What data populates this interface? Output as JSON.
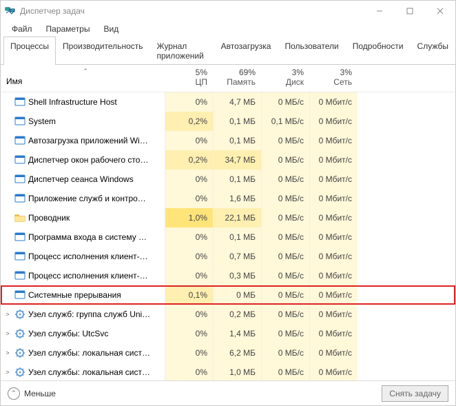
{
  "window": {
    "title": "Диспетчер задач"
  },
  "menu": {
    "file": "Файл",
    "options": "Параметры",
    "view": "Вид"
  },
  "tabs": {
    "processes": "Процессы",
    "performance": "Производительность",
    "apphistory": "Журнал приложений",
    "startup": "Автозагрузка",
    "users": "Пользователи",
    "details": "Подробности",
    "services": "Службы"
  },
  "columns": {
    "name": "Имя",
    "cpu": {
      "perc": "5%",
      "label": "ЦП"
    },
    "mem": {
      "perc": "69%",
      "label": "Память"
    },
    "disk": {
      "perc": "3%",
      "label": "Диск"
    },
    "net": {
      "perc": "3%",
      "label": "Сеть"
    }
  },
  "rows": [
    {
      "name": "Shell Infrastructure Host",
      "icon": "app",
      "cpu": "0%",
      "ch": 0,
      "mem": "4,7 МБ",
      "mh": 0,
      "disk": "0 МБ/с",
      "dh": 0,
      "net": "0 Мбит/с",
      "nh": 0,
      "expand": ""
    },
    {
      "name": "System",
      "icon": "app",
      "cpu": "0,2%",
      "ch": 1,
      "mem": "0,1 МБ",
      "mh": 0,
      "disk": "0,1 МБ/с",
      "dh": 0,
      "net": "0 Мбит/с",
      "nh": 0,
      "expand": ""
    },
    {
      "name": "Автозагрузка приложений Wi…",
      "icon": "app",
      "cpu": "0%",
      "ch": 0,
      "mem": "0,1 МБ",
      "mh": 0,
      "disk": "0 МБ/с",
      "dh": 0,
      "net": "0 Мбит/с",
      "nh": 0,
      "expand": ""
    },
    {
      "name": "Диспетчер окон рабочего сто…",
      "icon": "app",
      "cpu": "0,2%",
      "ch": 1,
      "mem": "34,7 МБ",
      "mh": 1,
      "disk": "0 МБ/с",
      "dh": 0,
      "net": "0 Мбит/с",
      "nh": 0,
      "expand": ""
    },
    {
      "name": "Диспетчер сеанса  Windows",
      "icon": "app",
      "cpu": "0%",
      "ch": 0,
      "mem": "0,1 МБ",
      "mh": 0,
      "disk": "0 МБ/с",
      "dh": 0,
      "net": "0 Мбит/с",
      "nh": 0,
      "expand": ""
    },
    {
      "name": "Приложение служб и контро…",
      "icon": "app",
      "cpu": "0%",
      "ch": 0,
      "mem": "1,6 МБ",
      "mh": 0,
      "disk": "0 МБ/с",
      "dh": 0,
      "net": "0 Мбит/с",
      "nh": 0,
      "expand": ""
    },
    {
      "name": "Проводник",
      "icon": "explorer",
      "cpu": "1,0%",
      "ch": 2,
      "mem": "22,1 МБ",
      "mh": 1,
      "disk": "0 МБ/с",
      "dh": 0,
      "net": "0 Мбит/с",
      "nh": 0,
      "expand": ""
    },
    {
      "name": "Программа входа в систему …",
      "icon": "app",
      "cpu": "0%",
      "ch": 0,
      "mem": "0,1 МБ",
      "mh": 0,
      "disk": "0 МБ/с",
      "dh": 0,
      "net": "0 Мбит/с",
      "nh": 0,
      "expand": ""
    },
    {
      "name": "Процесс исполнения клиент-…",
      "icon": "app",
      "cpu": "0%",
      "ch": 0,
      "mem": "0,7 МБ",
      "mh": 0,
      "disk": "0 МБ/с",
      "dh": 0,
      "net": "0 Мбит/с",
      "nh": 0,
      "expand": ""
    },
    {
      "name": "Процесс исполнения клиент-…",
      "icon": "app",
      "cpu": "0%",
      "ch": 0,
      "mem": "0,3 МБ",
      "mh": 0,
      "disk": "0 МБ/с",
      "dh": 0,
      "net": "0 Мбит/с",
      "nh": 0,
      "expand": ""
    },
    {
      "name": "Системные прерывания",
      "icon": "app",
      "cpu": "0,1%",
      "ch": 1,
      "mem": "0 МБ",
      "mh": 0,
      "disk": "0 МБ/с",
      "dh": 0,
      "net": "0 Мбит/с",
      "nh": 0,
      "expand": "",
      "highlight": true
    },
    {
      "name": "Узел служб: группа служб Uni…",
      "icon": "svc",
      "cpu": "0%",
      "ch": 0,
      "mem": "0,2 МБ",
      "mh": 0,
      "disk": "0 МБ/с",
      "dh": 0,
      "net": "0 Мбит/с",
      "nh": 0,
      "expand": ">"
    },
    {
      "name": "Узел службы: UtcSvc",
      "icon": "svc",
      "cpu": "0%",
      "ch": 0,
      "mem": "1,4 МБ",
      "mh": 0,
      "disk": "0 МБ/с",
      "dh": 0,
      "net": "0 Мбит/с",
      "nh": 0,
      "expand": ">"
    },
    {
      "name": "Узел службы: локальная сист…",
      "icon": "svc",
      "cpu": "0%",
      "ch": 0,
      "mem": "6,2 МБ",
      "mh": 0,
      "disk": "0 МБ/с",
      "dh": 0,
      "net": "0 Мбит/с",
      "nh": 0,
      "expand": ">"
    },
    {
      "name": "Узел службы: локальная сист…",
      "icon": "svc",
      "cpu": "0%",
      "ch": 0,
      "mem": "1,0 МБ",
      "mh": 0,
      "disk": "0 МБ/с",
      "dh": 0,
      "net": "0 Мбит/с",
      "nh": 0,
      "expand": ">"
    }
  ],
  "footer": {
    "fewer": "Меньше",
    "endtask": "Снять задачу"
  }
}
